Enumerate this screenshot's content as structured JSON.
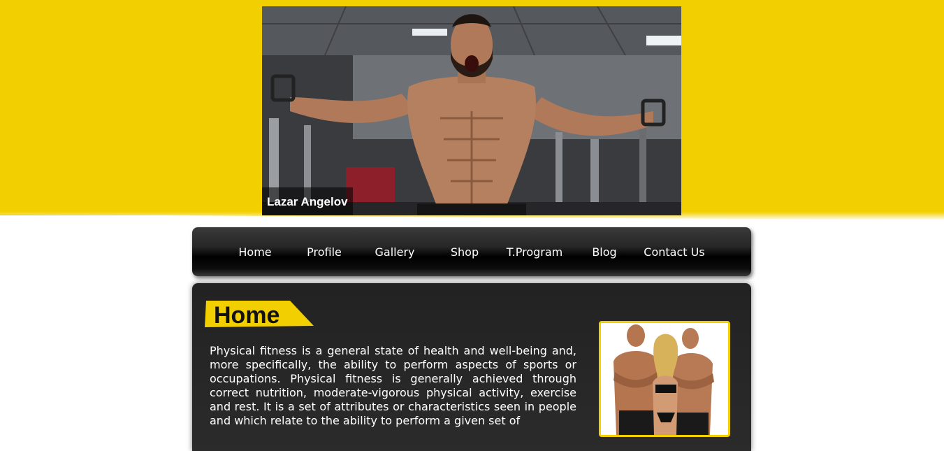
{
  "hero": {
    "caption": "Lazar Angelov",
    "image_icon": "bodybuilder-photo"
  },
  "nav": {
    "items": [
      {
        "label": "Home"
      },
      {
        "label": "Profile"
      },
      {
        "label": "Gallery"
      },
      {
        "label": "Shop"
      },
      {
        "label": "T.Program"
      },
      {
        "label": "Blog"
      },
      {
        "label": "Contact Us"
      }
    ]
  },
  "main": {
    "heading": "Home",
    "body": "Physical fitness is a general state of health and well-being and, more specifically, the ability to perform aspects of sports or occupations. Physical fitness is generally achieved through correct nutrition, moderate-vigorous physical activity, exercise and rest. It is a set of attributes or characteristics seen in people and which relate to the ability to perform a given set of",
    "side_image_icon": "fitness-group-photo"
  },
  "colors": {
    "accent_yellow": "#f2cf00",
    "nav_dark": "#000000",
    "panel_dark": "#262626",
    "text_light": "#ffffff"
  }
}
